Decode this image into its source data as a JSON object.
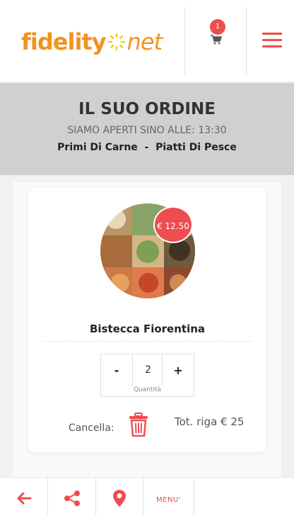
{
  "header": {
    "logo_text_primary": "fidelity",
    "logo_text_secondary": "net",
    "cart_count": "1",
    "icons": [
      "cart-icon",
      "menu-icon"
    ]
  },
  "banner": {
    "title": "IL SUO ORDINE",
    "open_until": "SIAMO APERTI SINO ALLE: 13:30",
    "categories": "Primi Di Carne  -  Piatti Di Pesce"
  },
  "order_item": {
    "price": "€ 12.50",
    "name": "Bistecca Fiorentina",
    "quantity": "2",
    "quantity_label": "Quantità",
    "minus_label": "-",
    "plus_label": "+",
    "cancel_label": "Cancella:",
    "row_total": "Tot. riga € 25"
  },
  "bottom_nav": {
    "back_icon": "arrow-left-icon",
    "share_icon": "share-icon",
    "location_icon": "location-pin-icon",
    "menu_label": "MENU'"
  },
  "colors": {
    "accent": "#ee4d4d",
    "logo": "#f3931f",
    "banner_bg": "#d0d0d0"
  }
}
